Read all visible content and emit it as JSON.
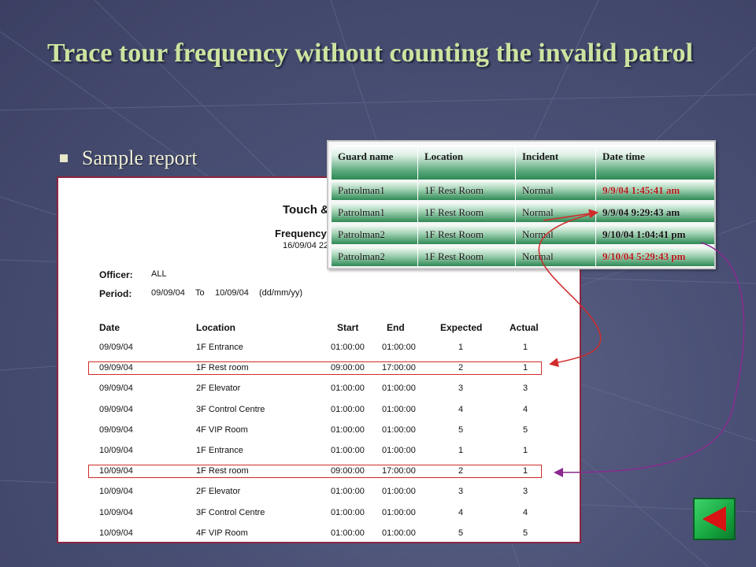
{
  "slide": {
    "title": "Trace tour frequency without counting the invalid patrol",
    "bullet": "Sample report"
  },
  "report": {
    "title": "Touch &",
    "subtitle": "Frequency",
    "printed": "16/09/04 22",
    "officer_label": "Officer:",
    "officer_value": "ALL",
    "period_label": "Period:",
    "period_from": "09/09/04",
    "period_to_label": "To",
    "period_to": "10/09/04",
    "period_format": "(dd/mm/yy)",
    "columns": [
      "Date",
      "Location",
      "Start",
      "End",
      "Expected",
      "Actual"
    ],
    "rows": [
      {
        "date": "09/09/04",
        "location": "1F Entrance",
        "start": "01:00:00",
        "end": "01:00:00",
        "expected": "1",
        "actual": "1"
      },
      {
        "date": "09/09/04",
        "location": "1F Rest room",
        "start": "09:00:00",
        "end": "17:00:00",
        "expected": "2",
        "actual": "1"
      },
      {
        "date": "09/09/04",
        "location": "2F Elevator",
        "start": "01:00:00",
        "end": "01:00:00",
        "expected": "3",
        "actual": "3"
      },
      {
        "date": "09/09/04",
        "location": "3F Control Centre",
        "start": "01:00:00",
        "end": "01:00:00",
        "expected": "4",
        "actual": "4"
      },
      {
        "date": "09/09/04",
        "location": "4F VIP Room",
        "start": "01:00:00",
        "end": "01:00:00",
        "expected": "5",
        "actual": "5"
      },
      {
        "date": "10/09/04",
        "location": "1F Entrance",
        "start": "01:00:00",
        "end": "01:00:00",
        "expected": "1",
        "actual": "1"
      },
      {
        "date": "10/09/04",
        "location": "1F Rest room",
        "start": "09:00:00",
        "end": "17:00:00",
        "expected": "2",
        "actual": "1"
      },
      {
        "date": "10/09/04",
        "location": "2F Elevator",
        "start": "01:00:00",
        "end": "01:00:00",
        "expected": "3",
        "actual": "3"
      },
      {
        "date": "10/09/04",
        "location": "3F Control Centre",
        "start": "01:00:00",
        "end": "01:00:00",
        "expected": "4",
        "actual": "4"
      },
      {
        "date": "10/09/04",
        "location": "4F VIP Room",
        "start": "01:00:00",
        "end": "01:00:00",
        "expected": "5",
        "actual": "5"
      }
    ],
    "highlighted_rows": [
      1,
      6
    ]
  },
  "incidents": {
    "columns": [
      "Guard name",
      "Location",
      "Incident",
      "Date time"
    ],
    "rows": [
      {
        "guard": "Patrolman1",
        "location": "1F Rest Room",
        "incident": "Normal",
        "datetime": "9/9/04 1:45:41 am",
        "invalid": true
      },
      {
        "guard": "Patrolman1",
        "location": "1F Rest Room",
        "incident": "Normal",
        "datetime": "9/9/04 9:29:43 am",
        "invalid": false
      },
      {
        "guard": "Patrolman2",
        "location": "1F Rest Room",
        "incident": "Normal",
        "datetime": "9/10/04 1:04:41 pm",
        "invalid": false
      },
      {
        "guard": "Patrolman2",
        "location": "1F Rest Room",
        "incident": "Normal",
        "datetime": "9/10/04 5:29:43 pm",
        "invalid": true
      }
    ]
  },
  "colors": {
    "title": "#cde3a0",
    "invalid_text": "#b01818",
    "highlight_box": "#d12b2b",
    "arrow_red": "#d12b2b",
    "arrow_purple": "#8a2a8f",
    "back_button": "#16a640"
  },
  "icons": {
    "back": "left-triangle-icon",
    "bullet": "square-bullet-icon"
  }
}
